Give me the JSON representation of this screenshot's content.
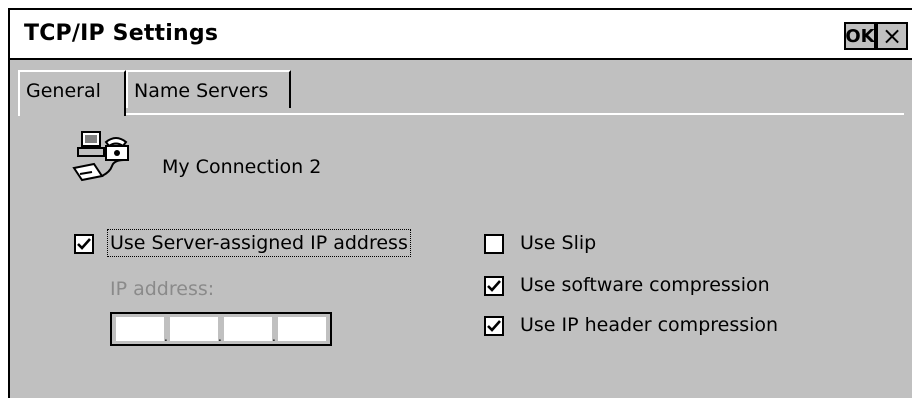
{
  "window": {
    "title": "TCP/IP Settings",
    "ok_label": "OK",
    "close_label": "×"
  },
  "tabs": [
    {
      "label": "General",
      "active": true
    },
    {
      "label": "Name Servers",
      "active": false
    }
  ],
  "connection": {
    "icon": "dialup-connection-icon",
    "name": "My Connection 2"
  },
  "options": {
    "server_assigned": {
      "label": "Use Server-assigned IP address",
      "checked": true
    },
    "ip_address": {
      "label": "IP address:",
      "value": "",
      "enabled": false
    },
    "use_slip": {
      "label": "Use Slip",
      "checked": false
    },
    "software_compression": {
      "label": "Use software compression",
      "checked": true
    },
    "ip_header_compression": {
      "label": "Use IP header compression",
      "checked": true
    }
  }
}
